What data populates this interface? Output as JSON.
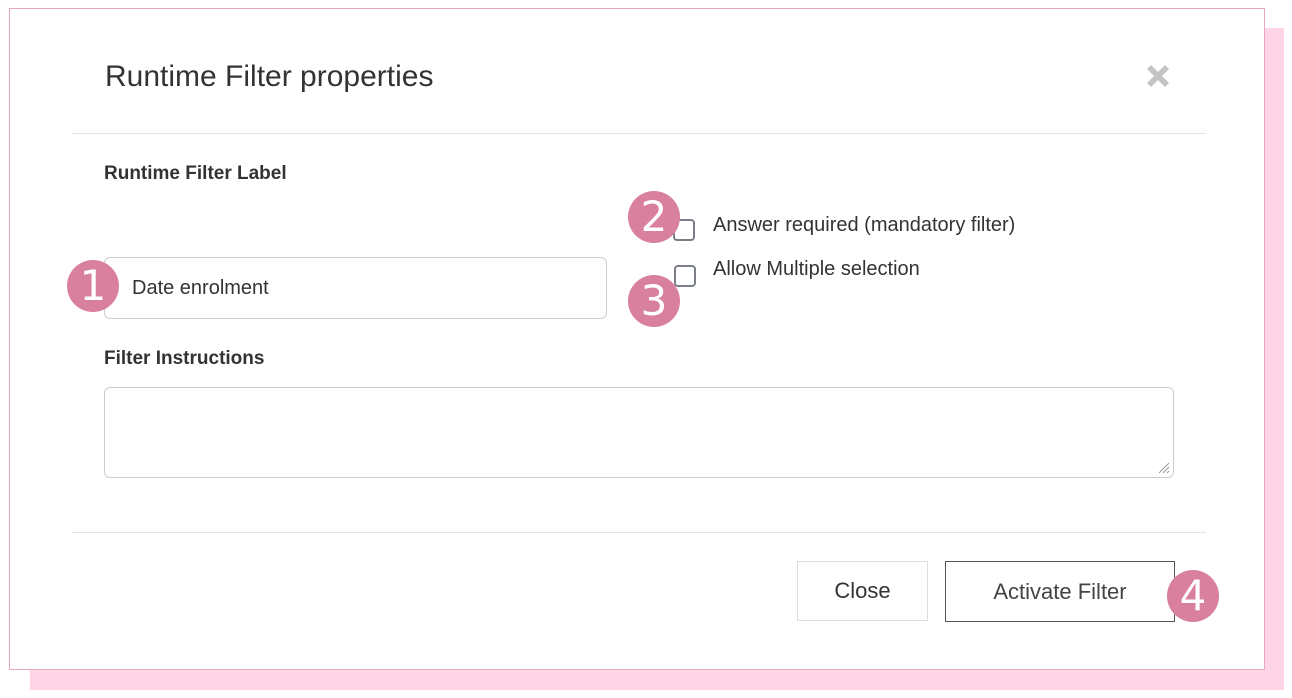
{
  "dialog": {
    "title": "Runtime Filter properties",
    "close_icon": "close-x-icon"
  },
  "form": {
    "label_heading": "Runtime Filter Label",
    "label_value": "Date enrolment",
    "answer_required": {
      "label": "Answer required (mandatory filter)",
      "checked": false
    },
    "allow_multiple": {
      "label": "Allow Multiple selection",
      "checked": false
    },
    "instructions_heading": "Filter Instructions",
    "instructions_value": ""
  },
  "footer": {
    "close_label": "Close",
    "activate_label": "Activate Filter"
  },
  "annotations": {
    "badge_1": "1",
    "badge_2": "2",
    "badge_3": "3",
    "badge_4": "4",
    "color": "#d9809f"
  },
  "colors": {
    "shadow": "#ffd4e6",
    "dialog_border": "#e8a8c4"
  }
}
